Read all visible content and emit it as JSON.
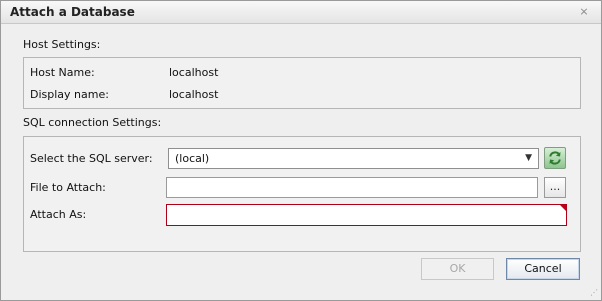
{
  "window": {
    "title": "Attach a Database",
    "close_glyph": "⨯"
  },
  "host_settings": {
    "heading": "Host Settings:",
    "host_name_label": "Host Name:",
    "host_name_value": "localhost",
    "display_name_label": "Display name:",
    "display_name_value": "localhost"
  },
  "sql_settings": {
    "heading": "SQL connection Settings:",
    "server_label": "Select the SQL server:",
    "server_value": "(local)",
    "file_label": "File to Attach:",
    "file_value": "",
    "attach_as_label": "Attach As:",
    "attach_as_value": "",
    "browse_label": "...",
    "refresh_icon": "refresh-icon"
  },
  "buttons": {
    "ok_label": "OK",
    "cancel_label": "Cancel",
    "ok_enabled": false
  },
  "colors": {
    "error_border": "#b00018",
    "refresh_green": "#2e8b2e"
  }
}
